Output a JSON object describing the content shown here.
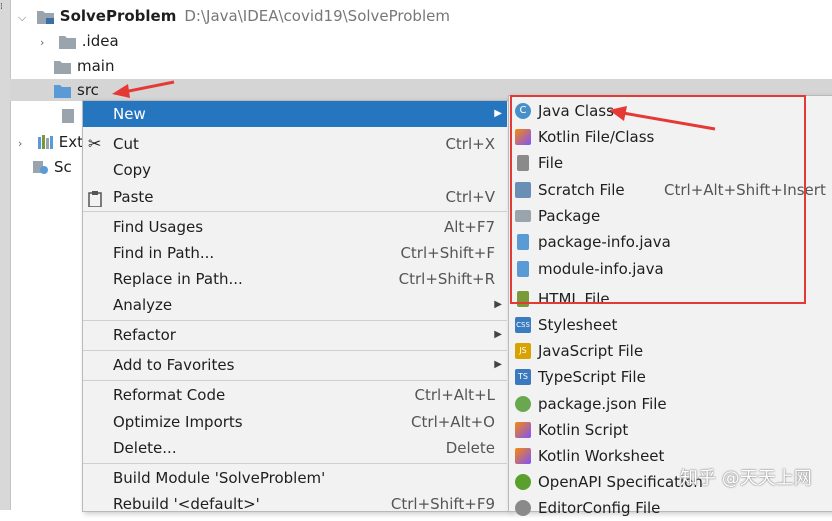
{
  "tree": {
    "project_name": "SolveProblem",
    "project_path": "D:\\Java\\IDEA\\covid19\\SolveProblem",
    "items": [
      {
        "label": ".idea"
      },
      {
        "label": "main"
      },
      {
        "label": "src"
      },
      {
        "label": "Ext"
      },
      {
        "label": "Sc"
      }
    ]
  },
  "context_menu": {
    "items": [
      {
        "label": "New",
        "shortcut": ""
      },
      {
        "label": "Cut",
        "shortcut": "Ctrl+X"
      },
      {
        "label": "Copy",
        "shortcut": ""
      },
      {
        "label": "Paste",
        "shortcut": "Ctrl+V"
      },
      {
        "label": "Find Usages",
        "shortcut": "Alt+F7"
      },
      {
        "label": "Find in Path...",
        "shortcut": "Ctrl+Shift+F"
      },
      {
        "label": "Replace in Path...",
        "shortcut": "Ctrl+Shift+R"
      },
      {
        "label": "Analyze",
        "shortcut": ""
      },
      {
        "label": "Refactor",
        "shortcut": ""
      },
      {
        "label": "Add to Favorites",
        "shortcut": ""
      },
      {
        "label": "Reformat Code",
        "shortcut": "Ctrl+Alt+L"
      },
      {
        "label": "Optimize Imports",
        "shortcut": "Ctrl+Alt+O"
      },
      {
        "label": "Delete...",
        "shortcut": "Delete"
      },
      {
        "label": "Build Module 'SolveProblem'",
        "shortcut": ""
      },
      {
        "label": "Rebuild '<default>'",
        "shortcut": "Ctrl+Shift+F9"
      }
    ]
  },
  "new_submenu": {
    "items": [
      {
        "label": "Java Class",
        "shortcut": "",
        "icon": "java-class-icon",
        "color": "#4a90c8"
      },
      {
        "label": "Kotlin File/Class",
        "shortcut": "",
        "icon": "kotlin-icon",
        "color": "#7f52ff"
      },
      {
        "label": "File",
        "shortcut": "",
        "icon": "file-icon",
        "color": "#8a8a8a"
      },
      {
        "label": "Scratch File",
        "shortcut": "Ctrl+Alt+Shift+Insert",
        "icon": "scratch-file-icon",
        "color": "#6a8fb5"
      },
      {
        "label": "Package",
        "shortcut": "",
        "icon": "package-icon",
        "color": "#9aa4ad"
      },
      {
        "label": "package-info.java",
        "shortcut": "",
        "icon": "java-file-icon",
        "color": "#5a9bd5"
      },
      {
        "label": "module-info.java",
        "shortcut": "",
        "icon": "java-file-icon",
        "color": "#5a9bd5"
      },
      {
        "label": "HTML File",
        "shortcut": "",
        "icon": "html-file-icon",
        "color": "#7a9a3a"
      },
      {
        "label": "Stylesheet",
        "shortcut": "",
        "icon": "css-file-icon",
        "color": "#3b7bbf"
      },
      {
        "label": "JavaScript File",
        "shortcut": "",
        "icon": "js-file-icon",
        "color": "#d8a300"
      },
      {
        "label": "TypeScript File",
        "shortcut": "",
        "icon": "ts-file-icon",
        "color": "#3a78c0"
      },
      {
        "label": "package.json File",
        "shortcut": "",
        "icon": "nodejs-icon",
        "color": "#6aa84f"
      },
      {
        "label": "Kotlin Script",
        "shortcut": "",
        "icon": "kotlin-icon",
        "color": "#7f52ff"
      },
      {
        "label": "Kotlin Worksheet",
        "shortcut": "",
        "icon": "kotlin-icon",
        "color": "#7f52ff"
      },
      {
        "label": "OpenAPI Specification",
        "shortcut": "",
        "icon": "openapi-icon",
        "color": "#5aa02c"
      },
      {
        "label": "EditorConfig File",
        "shortcut": "",
        "icon": "gear-icon",
        "color": "#8a8a8a"
      }
    ]
  },
  "watermark": "知乎 @天天上网",
  "colors": {
    "selection": "#2675bf",
    "annotation": "#e53935"
  }
}
